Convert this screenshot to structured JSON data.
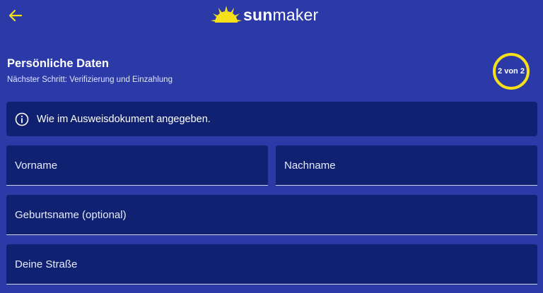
{
  "header": {
    "back_icon": "arrow-left-icon",
    "logo_icon": "sun-icon",
    "logo_bold": "sun",
    "logo_regular": "maker"
  },
  "section": {
    "title": "Persönliche Daten",
    "subtitle": "Nächster Schritt: Verifizierung und Einzahlung",
    "step": "2 von 2"
  },
  "info": {
    "icon": "info-circle-icon",
    "text": "Wie im Ausweisdokument angegeben."
  },
  "form": {
    "vorname": {
      "placeholder": "Vorname",
      "value": ""
    },
    "nachname": {
      "placeholder": "Nachname",
      "value": ""
    },
    "geburtsname": {
      "placeholder": "Geburtsname (optional)",
      "value": ""
    },
    "strasse": {
      "placeholder": "Deine Straße",
      "value": ""
    }
  },
  "colors": {
    "background": "#2b3aa6",
    "panel": "#0f2170",
    "accent_yellow": "#f6e01a",
    "text": "#ffffff"
  }
}
